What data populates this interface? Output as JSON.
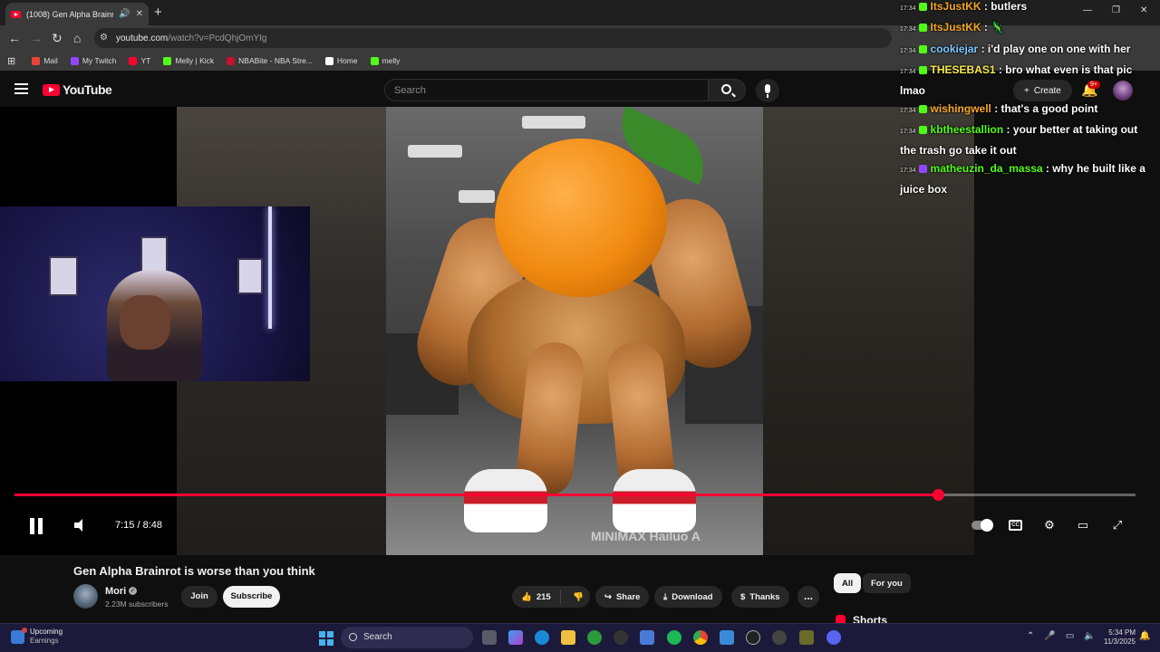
{
  "browser": {
    "tab_title": "(1008) Gen Alpha Brainrot i",
    "new_tab": "+",
    "url_host": "youtube.com",
    "url_path": "/watch?v=PcdQhjOmYIg",
    "bookmarks": [
      {
        "label": "Mail",
        "color": "#ea4335"
      },
      {
        "label": "My Twitch",
        "color": "#9146ff"
      },
      {
        "label": "YT",
        "color": "#ff0033"
      },
      {
        "label": "Melly | Kick",
        "color": "#53fc18"
      },
      {
        "label": "NBABite - NBA Stre...",
        "color": "#c8102e"
      },
      {
        "label": "Home",
        "color": "#ffffff"
      },
      {
        "label": "melly",
        "color": "#53fc18"
      }
    ]
  },
  "youtube": {
    "logo_text": "YouTube",
    "search_placeholder": "Search",
    "create_label": "Create",
    "notif_badge": "9+"
  },
  "player": {
    "current_time": "7:15",
    "duration": "8:48",
    "time_display": "7:15 / 8:48",
    "progress_fraction": 0.824,
    "watermark": "MINIMAX  Hailuo A",
    "cc_label": "CC"
  },
  "video": {
    "title": "Gen Alpha Brainrot is worse than you think",
    "channel": "Mori",
    "subscribers": "2.23M subscribers",
    "join_label": "Join",
    "subscribe_label": "Subscribe",
    "likes": "215",
    "share_label": "Share",
    "download_label": "Download",
    "thanks_label": "Thanks",
    "more_label": "..."
  },
  "sidebar": {
    "chips": [
      "All",
      "For you"
    ],
    "shorts_label": "Shorts"
  },
  "chat": [
    {
      "time": "17:34",
      "user": "ItsJustKK",
      "color": "#f5a623",
      "text": "butlers"
    },
    {
      "time": "17:34",
      "user": "ItsJustKK",
      "color": "#f5a623",
      "text": ""
    },
    {
      "time": "17:34",
      "user": "cookiejar",
      "color": "#7ec8ff",
      "text": "i'd play one on one with her"
    },
    {
      "time": "17:34",
      "user": "THESEBAS1",
      "color": "#f7e84a",
      "text": "bro what even is that pic lmao"
    },
    {
      "time": "17:34",
      "user": "wishingwell",
      "color": "#f5a623",
      "text": "that's a good point"
    },
    {
      "time": "17:34",
      "user": "kbtheestallion",
      "color": "#53fc18",
      "text": "your better at taking out the trash go take it out"
    },
    {
      "time": "17:34",
      "user": "matheuzin_da_massa",
      "color": "#53fc18",
      "text": "why he built like a juice box"
    }
  ],
  "taskbar": {
    "weather_title": "Upcoming",
    "weather_sub": "Earnings",
    "search_label": "Search",
    "time": "5:34 PM",
    "date": "11/3/2025"
  }
}
